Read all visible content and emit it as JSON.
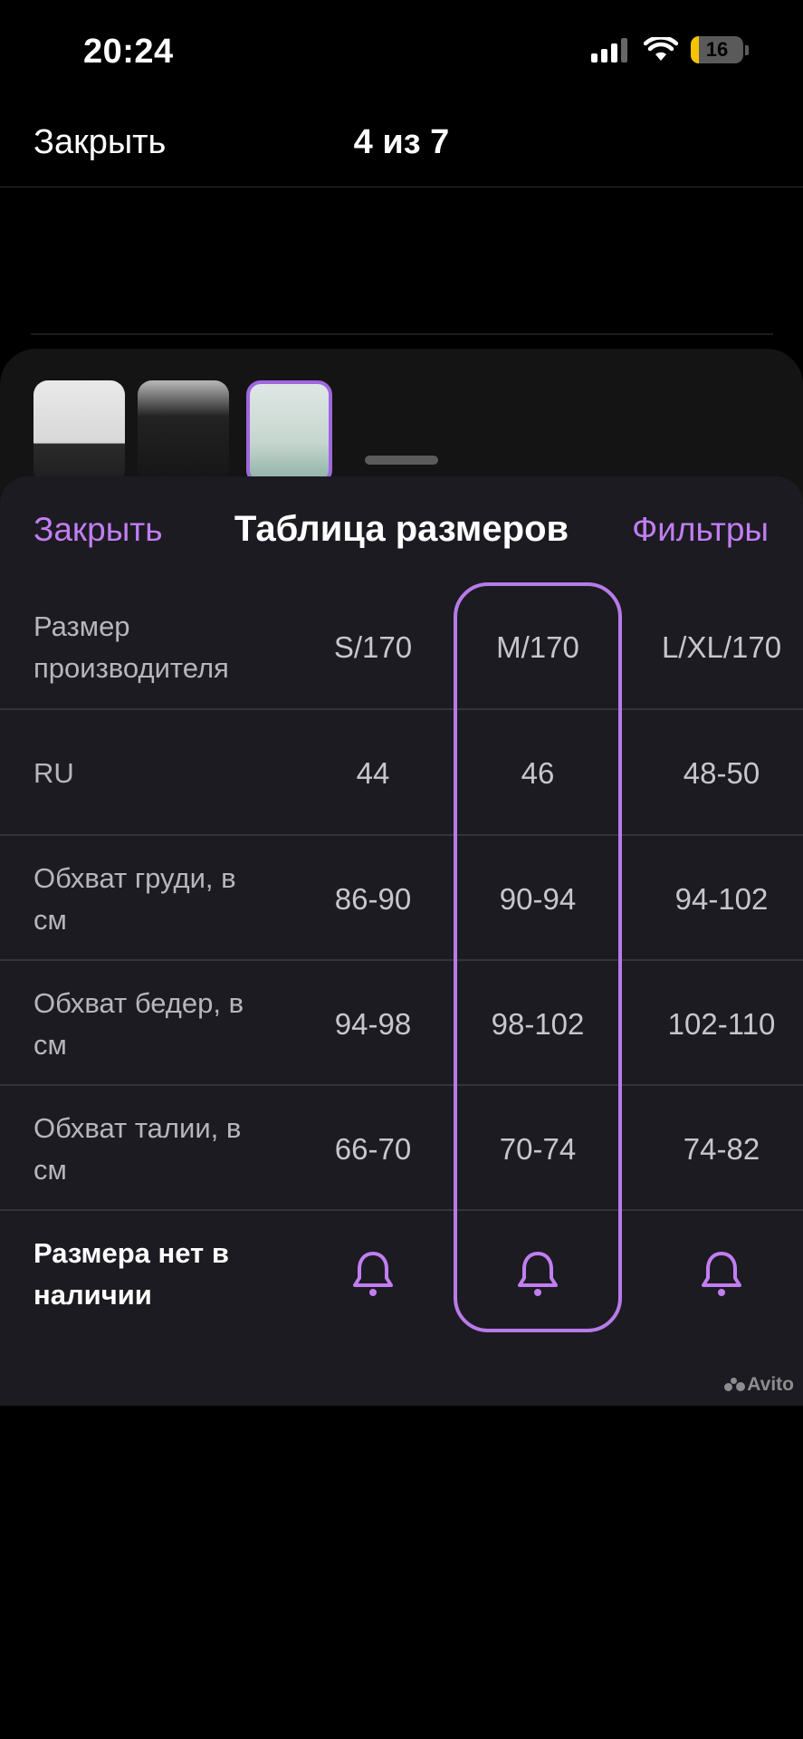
{
  "status_bar": {
    "time": "20:24",
    "battery_level": "16",
    "battery_color": "#f5c400"
  },
  "top_bar": {
    "close_label": "Закрыть",
    "counter": "4 из 7"
  },
  "size_sheet": {
    "close_label": "Закрыть",
    "title": "Таблица размеров",
    "filters_label": "Фильтры",
    "accent_color": "#c17ef2",
    "selected_column": "M/170",
    "rows": [
      {
        "label": "Размер производителя",
        "values": [
          "S/170",
          "M/170",
          "L/XL/170"
        ]
      },
      {
        "label": "RU",
        "values": [
          "44",
          "46",
          "48-50"
        ]
      },
      {
        "label": "Обхват груди, в см",
        "values": [
          "86-90",
          "90-94",
          "94-102"
        ]
      },
      {
        "label": "Обхват бедер, в см",
        "values": [
          "94-98",
          "98-102",
          "102-110"
        ]
      },
      {
        "label": "Обхват талии, в см",
        "values": [
          "66-70",
          "70-74",
          "74-82"
        ]
      }
    ],
    "not_available_label": "Размера нет в наличии",
    "notify_icon": "bell-icon"
  },
  "watermark": "Avito"
}
